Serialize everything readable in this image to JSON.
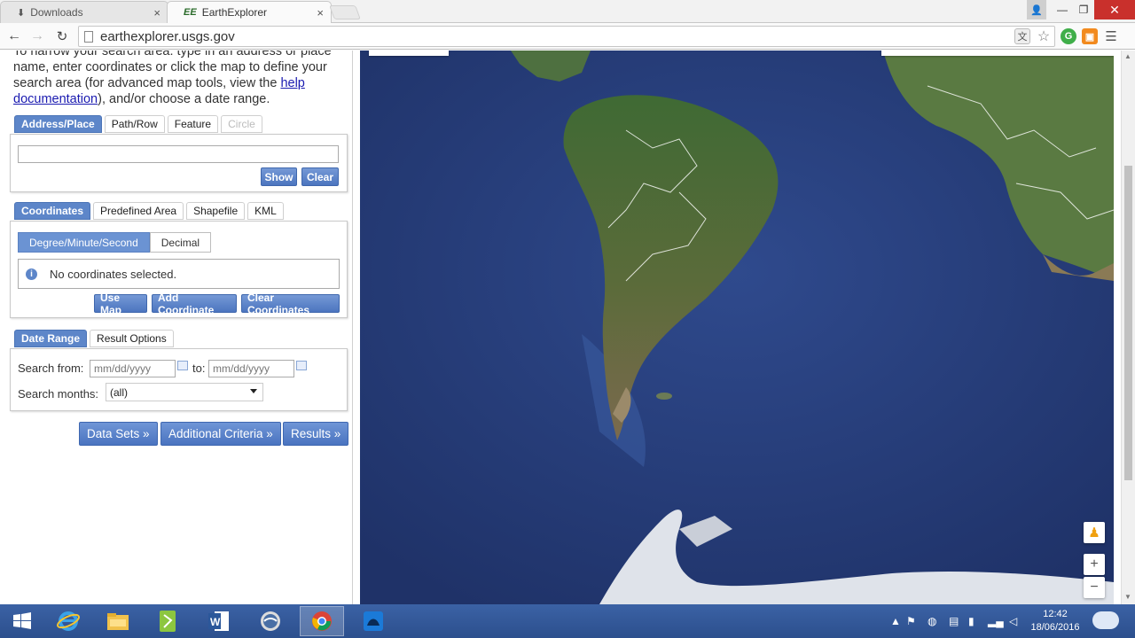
{
  "browser": {
    "tabs": [
      {
        "label": "Downloads",
        "icon": "download-icon"
      },
      {
        "label": "EarthExplorer",
        "icon": "EE"
      }
    ],
    "url": "earthexplorer.usgs.gov"
  },
  "intro": {
    "text_before_link": "To narrow your search area: type in an address or place name, enter coordinates or click the map to define your search area (for advanced map tools, view the ",
    "link_text": "help documentation",
    "text_after_link": "), and/or choose a date range."
  },
  "address_tabs": [
    "Address/Place",
    "Path/Row",
    "Feature",
    "Circle"
  ],
  "address_box": {
    "input_value": "",
    "show_label": "Show",
    "clear_label": "Clear"
  },
  "coordinate_tabs": [
    "Coordinates",
    "Predefined Area",
    "Shapefile",
    "KML"
  ],
  "coordinates_box": {
    "format_options": [
      "Degree/Minute/Second",
      "Decimal"
    ],
    "notice": "No coordinates selected.",
    "use_map_label": "Use Map",
    "add_coordinate_label": "Add Coordinate",
    "clear_coordinates_label": "Clear Coordinates"
  },
  "date_tabs": [
    "Date Range",
    "Result Options"
  ],
  "date_box": {
    "search_from_label": "Search from:",
    "from_placeholder": "mm/dd/yyyy",
    "to_label": "to:",
    "to_placeholder": "mm/dd/yyyy",
    "months_label": "Search months:",
    "months_value": "(all)"
  },
  "nav_buttons": [
    "Data Sets »",
    "Additional Criteria »",
    "Results »"
  ],
  "taskbar": {
    "time": "12:42",
    "date": "18/06/2016"
  },
  "colors": {
    "accent": "#5d86c9",
    "ocean": "#2a3f7d",
    "land": "#4b6a36",
    "taskbar": "#2c4f8d"
  }
}
